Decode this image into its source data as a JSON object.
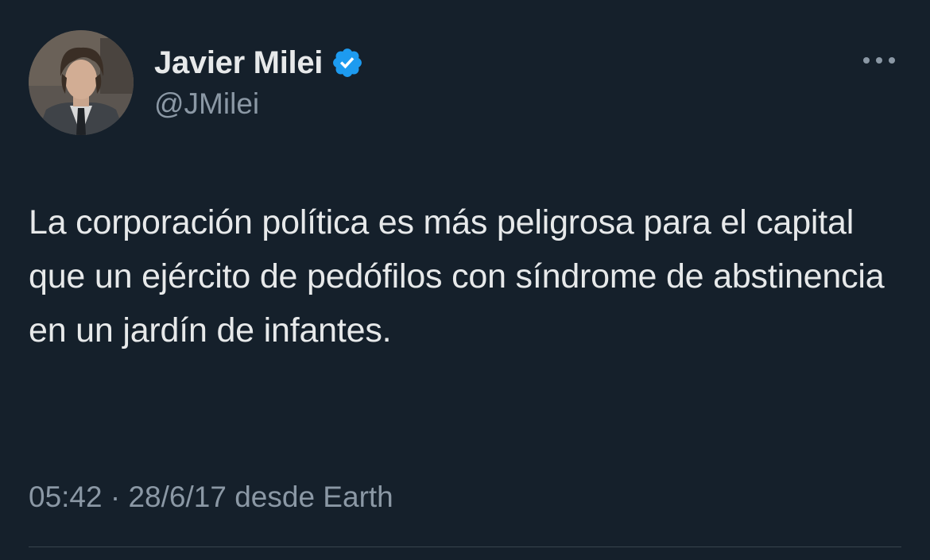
{
  "author": {
    "display_name": "Javier Milei",
    "handle": "@JMilei",
    "verified": true,
    "avatar_icon": "profile-photo",
    "verified_icon": "verified-badge-icon",
    "verified_color": "#1d9bf0"
  },
  "more_icon": "more-horizontal-icon",
  "tweet": {
    "text": "La corporación política es más peligrosa para el capital que un ejército de pedófilos con síndrome de abstinencia en un jardín de infantes.",
    "time": "05:42",
    "separator": "·",
    "date": "28/6/17",
    "source": "desde Earth"
  },
  "colors": {
    "background": "#15202b",
    "primary_text": "#e7e9ea",
    "secondary_text": "#8b98a5",
    "divider": "#38444d"
  }
}
